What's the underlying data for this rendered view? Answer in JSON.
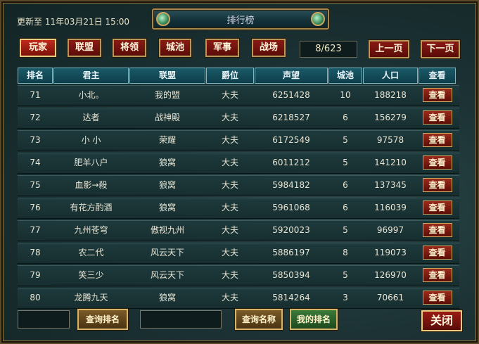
{
  "update_text": "更新至 11年03月21日 15:00",
  "window_title": "排行榜",
  "tabs": [
    "玩家",
    "联盟",
    "将领",
    "城池",
    "军事",
    "战场"
  ],
  "page_indicator": "8/623",
  "prev_label": "上一页",
  "next_label": "下一页",
  "columns": [
    "排名",
    "君主",
    "联盟",
    "爵位",
    "声望",
    "城池",
    "人口",
    "查看"
  ],
  "rows": [
    [
      "71",
      "小北。",
      "我的盟",
      "大夫",
      "6251428",
      "10",
      "188218",
      "查看"
    ],
    [
      "72",
      "达者",
      "战神殿",
      "大夫",
      "6218527",
      "6",
      "156279",
      "查看"
    ],
    [
      "73",
      "小 小",
      "荣耀",
      "大夫",
      "6172549",
      "5",
      "97578",
      "查看"
    ],
    [
      "74",
      "肥羊八户",
      "狼窝",
      "大夫",
      "6011212",
      "5",
      "141210",
      "查看"
    ],
    [
      "75",
      "血影→殺",
      "狼窝",
      "大夫",
      "5984182",
      "6",
      "137345",
      "查看"
    ],
    [
      "76",
      "有花方酌酒",
      "狼窝",
      "大夫",
      "5961068",
      "6",
      "116039",
      "查看"
    ],
    [
      "77",
      "九州苍穹",
      "傲视九州",
      "大夫",
      "5920023",
      "5",
      "96997",
      "查看"
    ],
    [
      "78",
      "农二代",
      "风云天下",
      "大夫",
      "5886197",
      "8",
      "119073",
      "查看"
    ],
    [
      "79",
      "笑三少",
      "风云天下",
      "大夫",
      "5850394",
      "5",
      "126970",
      "查看"
    ],
    [
      "80",
      "龙腾九天",
      "狼窝",
      "大夫",
      "5814264",
      "3",
      "70661",
      "查看"
    ]
  ],
  "search_rank_label": "查询排名",
  "search_name_label": "查询名称",
  "my_rank_label": "我的排名",
  "close_label": "关闭"
}
